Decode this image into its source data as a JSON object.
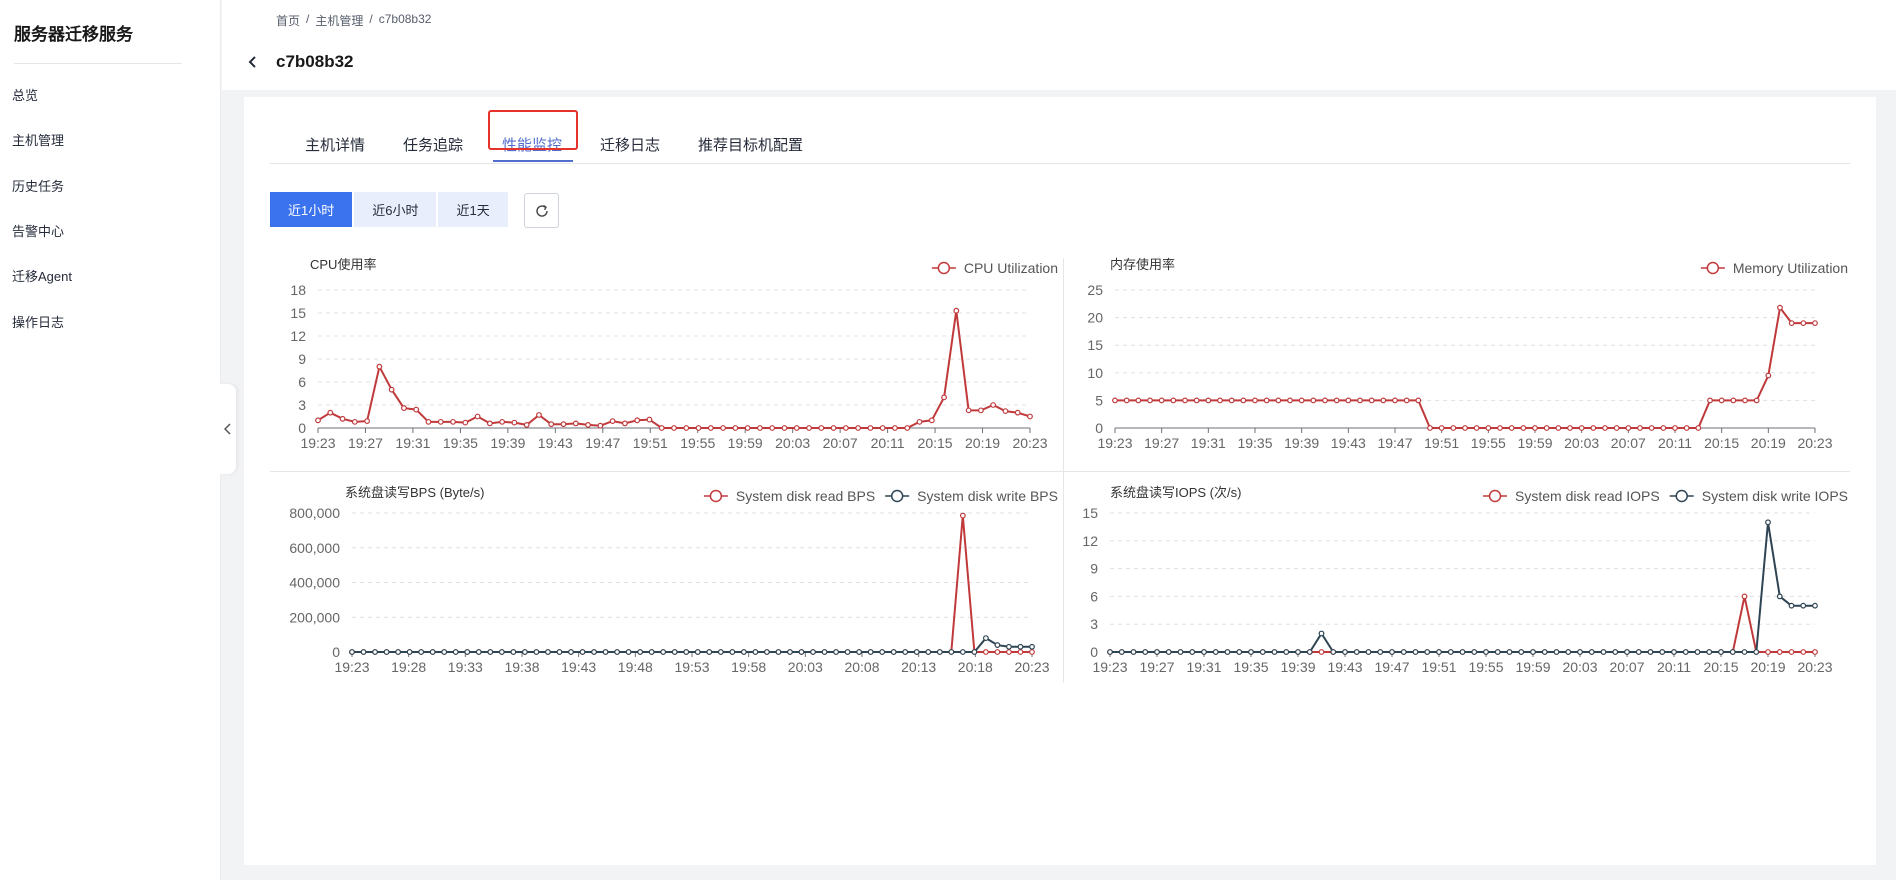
{
  "app": {
    "title": "服务器迁移服务"
  },
  "sidebar": {
    "items": [
      {
        "label": "总览",
        "name": "overview"
      },
      {
        "label": "主机管理",
        "name": "host-management"
      },
      {
        "label": "历史任务",
        "name": "history-tasks"
      },
      {
        "label": "告警中心",
        "name": "alarm-center"
      },
      {
        "label": "迁移Agent",
        "name": "migration-agent"
      },
      {
        "label": "操作日志",
        "name": "operation-log"
      }
    ]
  },
  "breadcrumb": [
    "首页",
    "/",
    "主机管理",
    "/",
    "c7b08b32"
  ],
  "header": {
    "title": "c7b08b32"
  },
  "tabs": [
    {
      "label": "主机详情",
      "active": false
    },
    {
      "label": "任务追踪",
      "active": false
    },
    {
      "label": "性能监控",
      "active": true
    },
    {
      "label": "迁移日志",
      "active": false
    },
    {
      "label": "推荐目标机配置",
      "active": false
    }
  ],
  "time_range": {
    "options": [
      "近1小时",
      "近6小时",
      "近1天"
    ],
    "selected": "近1小时"
  },
  "chart_data": [
    {
      "type": "line",
      "title": "CPU使用率",
      "legend_position": "top-right",
      "ylim": [
        0,
        18
      ],
      "yticks": [
        "0",
        "3",
        "6",
        "9",
        "12",
        "15",
        "18"
      ],
      "xticks": [
        "19:23",
        "19:27",
        "19:31",
        "19:35",
        "19:39",
        "19:43",
        "19:47",
        "19:51",
        "19:55",
        "19:59",
        "20:03",
        "20:07",
        "20:11",
        "20:15",
        "20:19",
        "20:23"
      ],
      "series": [
        {
          "name": "CPU Utilization",
          "color": "#c0393b",
          "values": [
            1,
            2,
            1.2,
            0.8,
            0.9,
            8,
            5,
            2.6,
            2.4,
            0.8,
            0.8,
            0.8,
            0.7,
            1.5,
            0.6,
            0.8,
            0.7,
            0.4,
            1.7,
            0.5,
            0.5,
            0.6,
            0.4,
            0.3,
            0.9,
            0.6,
            1,
            1.1,
            0,
            0,
            0,
            0,
            0,
            0,
            0,
            0,
            0,
            0,
            0,
            0,
            0,
            0,
            0,
            0,
            0,
            0,
            0,
            0,
            0,
            0.8,
            1,
            4,
            15.3,
            2.3,
            2.3,
            3,
            2.2,
            2,
            1.5
          ]
        }
      ]
    },
    {
      "type": "line",
      "title": "内存使用率",
      "legend_position": "top-right",
      "ylim": [
        0,
        25
      ],
      "yticks": [
        "0",
        "5",
        "10",
        "15",
        "20",
        "25"
      ],
      "xticks": [
        "19:23",
        "19:27",
        "19:31",
        "19:35",
        "19:39",
        "19:43",
        "19:47",
        "19:51",
        "19:55",
        "19:59",
        "20:03",
        "20:07",
        "20:11",
        "20:15",
        "20:19",
        "20:23"
      ],
      "series": [
        {
          "name": "Memory Utilization",
          "color": "#c0393b",
          "values": [
            5,
            5,
            5,
            5,
            5,
            5,
            5,
            5,
            5,
            5,
            5,
            5,
            5,
            5,
            5,
            5,
            5,
            5,
            5,
            5,
            5,
            5,
            5,
            5,
            5,
            5,
            5,
            0,
            0,
            0,
            0,
            0,
            0,
            0,
            0,
            0,
            0,
            0,
            0,
            0,
            0,
            0,
            0,
            0,
            0,
            0,
            0,
            0,
            0,
            0,
            0,
            5,
            5,
            5,
            5,
            5,
            9.5,
            21.8,
            19,
            19,
            19
          ]
        }
      ]
    },
    {
      "type": "line",
      "title": "系统盘读写BPS (Byte/s)",
      "legend_position": "top-right",
      "ylim": [
        0,
        800000
      ],
      "yticks": [
        "0",
        "200,000",
        "400,000",
        "600,000",
        "800,000"
      ],
      "xticks": [
        "19:23",
        "19:28",
        "19:33",
        "19:38",
        "19:43",
        "19:48",
        "19:53",
        "19:58",
        "20:03",
        "20:08",
        "20:13",
        "20:18",
        "20:23"
      ],
      "series": [
        {
          "name": "System disk read BPS",
          "color": "#c0393b",
          "values": [
            0,
            0,
            0,
            0,
            0,
            0,
            0,
            0,
            0,
            0,
            0,
            0,
            0,
            0,
            0,
            0,
            0,
            0,
            0,
            0,
            0,
            0,
            0,
            0,
            0,
            0,
            0,
            0,
            0,
            0,
            0,
            0,
            0,
            0,
            0,
            0,
            0,
            0,
            0,
            0,
            0,
            0,
            0,
            0,
            0,
            0,
            0,
            0,
            0,
            0,
            0,
            0,
            0,
            785000,
            0,
            0,
            0,
            0,
            0,
            0
          ]
        },
        {
          "name": "System disk write BPS",
          "color": "#2f4554",
          "values": [
            0,
            0,
            0,
            0,
            0,
            0,
            0,
            0,
            0,
            0,
            0,
            0,
            0,
            0,
            0,
            0,
            0,
            0,
            0,
            0,
            0,
            0,
            0,
            0,
            0,
            0,
            0,
            0,
            0,
            0,
            0,
            0,
            0,
            0,
            0,
            0,
            0,
            0,
            0,
            0,
            0,
            0,
            0,
            0,
            0,
            0,
            0,
            0,
            0,
            0,
            0,
            0,
            0,
            0,
            0,
            80000,
            40000,
            30000,
            30000,
            30000
          ]
        }
      ]
    },
    {
      "type": "line",
      "title": "系统盘读写IOPS (次/s)",
      "legend_position": "top-right",
      "ylim": [
        0,
        15
      ],
      "yticks": [
        "0",
        "3",
        "6",
        "9",
        "12",
        "15"
      ],
      "xticks": [
        "19:23",
        "19:27",
        "19:31",
        "19:35",
        "19:39",
        "19:43",
        "19:47",
        "19:51",
        "19:55",
        "19:59",
        "20:03",
        "20:07",
        "20:11",
        "20:15",
        "20:19",
        "20:23"
      ],
      "series": [
        {
          "name": "System disk read IOPS",
          "color": "#c0393b",
          "values": [
            0,
            0,
            0,
            0,
            0,
            0,
            0,
            0,
            0,
            0,
            0,
            0,
            0,
            0,
            0,
            0,
            0,
            0,
            0,
            0,
            0,
            0,
            0,
            0,
            0,
            0,
            0,
            0,
            0,
            0,
            0,
            0,
            0,
            0,
            0,
            0,
            0,
            0,
            0,
            0,
            0,
            0,
            0,
            0,
            0,
            0,
            0,
            0,
            0,
            0,
            0,
            0,
            0,
            0,
            6,
            0,
            0,
            0,
            0,
            0,
            0
          ]
        },
        {
          "name": "System disk  write IOPS",
          "color": "#2f4554",
          "values": [
            0,
            0,
            0,
            0,
            0,
            0,
            0,
            0,
            0,
            0,
            0,
            0,
            0,
            0,
            0,
            0,
            0,
            0,
            2,
            0,
            0,
            0,
            0,
            0,
            0,
            0,
            0,
            0,
            0,
            0,
            0,
            0,
            0,
            0,
            0,
            0,
            0,
            0,
            0,
            0,
            0,
            0,
            0,
            0,
            0,
            0,
            0,
            0,
            0,
            0,
            0,
            0,
            0,
            0,
            0,
            0,
            14,
            6,
            5,
            5,
            5
          ]
        }
      ]
    }
  ]
}
